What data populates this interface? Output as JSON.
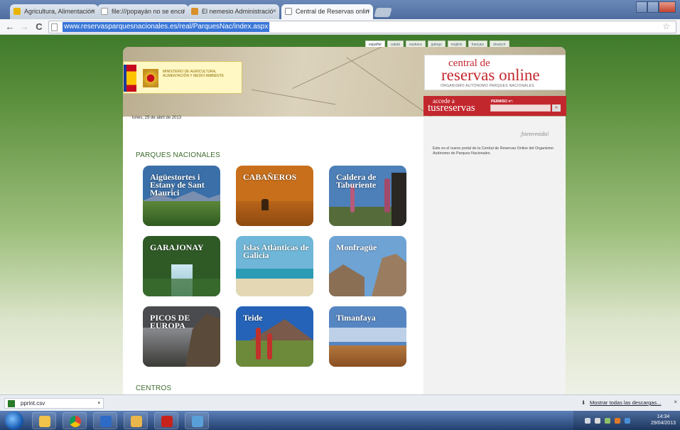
{
  "browser": {
    "tabs": [
      {
        "title": "Agricultura, Alimentación",
        "icon": "ministry-tab-icon"
      },
      {
        "title": "file:///popayán no se encu",
        "icon": "file-tab-icon"
      },
      {
        "title": "El nemesio Administració",
        "icon": "admin-tab-icon"
      },
      {
        "title": "Central de Reservas onlin",
        "icon": "document-tab-icon",
        "active": true
      }
    ],
    "close_glyph": "×",
    "url": "www.reservasparquesnacionales.es/real/ParquesNac/index.aspx",
    "nav": {
      "back": "←",
      "forward": "→",
      "reload": "C",
      "star": "☆"
    }
  },
  "page": {
    "languages": [
      "español",
      "català",
      "euskara",
      "galego",
      "english",
      "français",
      "deutsch"
    ],
    "ministry_text": "MINISTERIO DE AGRICULTURA, ALIMENTACIÓN Y MEDIO AMBIENTE",
    "brand": {
      "line1": "central de",
      "line2": "reservas online",
      "subtitle": "ORGANISMO AUTÓNOMO PARQUES NACIONALES"
    },
    "accede": {
      "line1": "accede a",
      "line2": "tusreservas",
      "permiso_label": "PERMISO nº:",
      "go": "»"
    },
    "date": "lunes, 29 de abril de 2013",
    "welcome": "¡bienvenido!",
    "sidebar_text": "Este es el nuevo portal de la Central de Reservas Online del Organismo Autónomo de Parques Nacionales.",
    "section_parks": "PARQUES NACIONALES",
    "section_centers": "CENTROS",
    "parks": [
      {
        "name": "Aigüestortes i Estany de Sant Maurici",
        "bg": "#3a6fa8"
      },
      {
        "name": "CABAÑEROS",
        "bg": "#c86f1c"
      },
      {
        "name": "Caldera de Taburiente",
        "bg": "#4d7fb8"
      },
      {
        "name": "GARAJONAY",
        "bg": "#2f5a26"
      },
      {
        "name": "Islas Atlánticas de Galicia",
        "bg": "#6fb6d8"
      },
      {
        "name": "Monfragüe",
        "bg": "#6ea3d4"
      },
      {
        "name": "PICOS DE EUROPA",
        "bg": "#4a4b4e"
      },
      {
        "name": "Teide",
        "bg": "#2563b8"
      },
      {
        "name": "Timanfaya",
        "bg": "#5686c2"
      }
    ]
  },
  "downloads": {
    "file": "pprint.csv",
    "show_all": "Mostrar todas las descargas...",
    "close": "×"
  },
  "taskbar": {
    "time": "14:34",
    "date": "29/04/2013",
    "apps": [
      "explorer",
      "chrome",
      "outlook",
      "folder",
      "acrobat",
      "network"
    ]
  }
}
